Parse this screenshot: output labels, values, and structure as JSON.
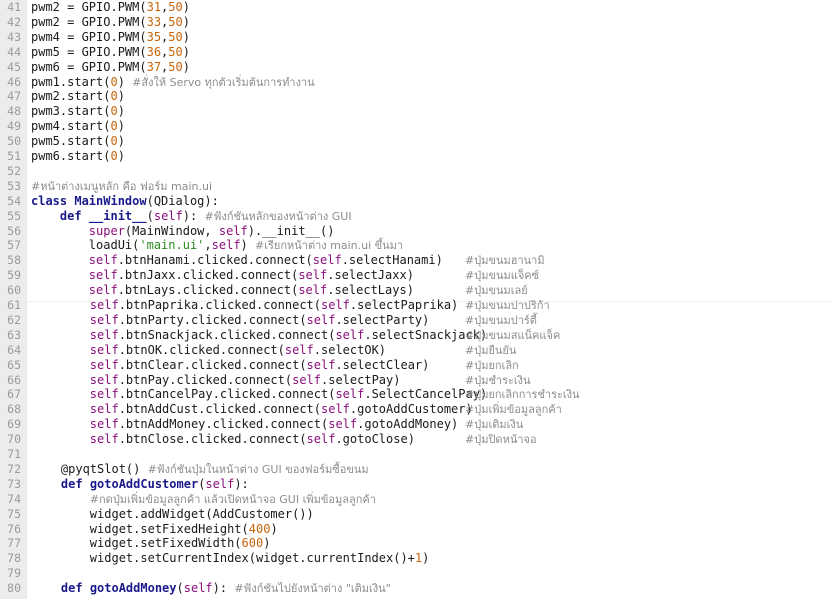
{
  "editor": {
    "lines": [
      {
        "num": "41",
        "tokens": [
          [
            "n",
            "pwm2 = GPIO.PWM("
          ],
          [
            "num",
            "31"
          ],
          [
            "n",
            ","
          ],
          [
            "num",
            "50"
          ],
          [
            "n",
            ")"
          ]
        ]
      },
      {
        "num": "42",
        "tokens": [
          [
            "n",
            "pwm2 = GPIO.PWM("
          ],
          [
            "num",
            "33"
          ],
          [
            "n",
            ","
          ],
          [
            "num",
            "50"
          ],
          [
            "n",
            ")"
          ]
        ]
      },
      {
        "num": "43",
        "tokens": [
          [
            "n",
            "pwm4 = GPIO.PWM("
          ],
          [
            "num",
            "35"
          ],
          [
            "n",
            ","
          ],
          [
            "num",
            "50"
          ],
          [
            "n",
            ")"
          ]
        ]
      },
      {
        "num": "44",
        "tokens": [
          [
            "n",
            "pwm5 = GPIO.PWM("
          ],
          [
            "num",
            "36"
          ],
          [
            "n",
            ","
          ],
          [
            "num",
            "50"
          ],
          [
            "n",
            ")"
          ]
        ]
      },
      {
        "num": "45",
        "tokens": [
          [
            "n",
            "pwm6 = GPIO.PWM("
          ],
          [
            "num",
            "37"
          ],
          [
            "n",
            ","
          ],
          [
            "num",
            "50"
          ],
          [
            "n",
            ")"
          ]
        ]
      },
      {
        "num": "46",
        "tokens": [
          [
            "n",
            "pwm1.start("
          ],
          [
            "num",
            "0"
          ],
          [
            "n",
            ") "
          ],
          [
            "cmt",
            "#สั่งให้ Servo ทุกตัวเริ่มต้นการทำงาน"
          ]
        ]
      },
      {
        "num": "47",
        "tokens": [
          [
            "n",
            "pwm2.start("
          ],
          [
            "num",
            "0"
          ],
          [
            "n",
            ")"
          ]
        ]
      },
      {
        "num": "48",
        "tokens": [
          [
            "n",
            "pwm3.start("
          ],
          [
            "num",
            "0"
          ],
          [
            "n",
            ")"
          ]
        ]
      },
      {
        "num": "49",
        "tokens": [
          [
            "n",
            "pwm4.start("
          ],
          [
            "num",
            "0"
          ],
          [
            "n",
            ")"
          ]
        ]
      },
      {
        "num": "50",
        "tokens": [
          [
            "n",
            "pwm5.start("
          ],
          [
            "num",
            "0"
          ],
          [
            "n",
            ")"
          ]
        ]
      },
      {
        "num": "51",
        "tokens": [
          [
            "n",
            "pwm6.start("
          ],
          [
            "num",
            "0"
          ],
          [
            "n",
            ")"
          ]
        ]
      },
      {
        "num": "52",
        "tokens": []
      },
      {
        "num": "53",
        "tokens": [
          [
            "cmt",
            "#หน้าต่างเมนูหลัก คือ ฟอร์ม main.ui"
          ]
        ]
      },
      {
        "num": "54",
        "tokens": [
          [
            "kw",
            "class "
          ],
          [
            "cls",
            "MainWindow"
          ],
          [
            "n",
            "(QDialog):"
          ]
        ]
      },
      {
        "num": "55",
        "tokens": [
          [
            "n",
            "    "
          ],
          [
            "kw",
            "def "
          ],
          [
            "fn",
            "__init__"
          ],
          [
            "n",
            "("
          ],
          [
            "self",
            "self"
          ],
          [
            "n",
            "): "
          ],
          [
            "cmt",
            "#ฟังก์ชันหลักของหน้าต่าง GUI"
          ]
        ]
      },
      {
        "num": "56",
        "tokens": [
          [
            "n",
            "        "
          ],
          [
            "self",
            "super"
          ],
          [
            "n",
            "(MainWindow, "
          ],
          [
            "self",
            "self"
          ],
          [
            "n",
            ").__init__()"
          ]
        ]
      },
      {
        "num": "57",
        "tokens": [
          [
            "n",
            "        loadUi("
          ],
          [
            "str",
            "'main.ui'"
          ],
          [
            "n",
            ","
          ],
          [
            "self",
            "self"
          ],
          [
            "n",
            ") "
          ],
          [
            "cmt",
            "#เรียกหน้าต่าง main.ui ขึ้นมา"
          ]
        ]
      },
      {
        "num": "58",
        "tokens": [
          [
            "n",
            "        "
          ],
          [
            "self",
            "self"
          ],
          [
            "n",
            ".btnHanami.clicked.connect("
          ],
          [
            "self",
            "self"
          ],
          [
            "n",
            ".selectHanami)"
          ]
        ],
        "comment": "#ปุ่มขนมฮานามิ"
      },
      {
        "num": "59",
        "tokens": [
          [
            "n",
            "        "
          ],
          [
            "self",
            "self"
          ],
          [
            "n",
            ".btnJaxx.clicked.connect("
          ],
          [
            "self",
            "self"
          ],
          [
            "n",
            ".selectJaxx)"
          ]
        ],
        "comment": "#ปุ่มขนมแจ็คซ์"
      },
      {
        "num": "60",
        "tokens": [
          [
            "n",
            "        "
          ],
          [
            "self",
            "self"
          ],
          [
            "n",
            ".btnLays.clicked.connect("
          ],
          [
            "self",
            "self"
          ],
          [
            "n",
            ".selectLays)"
          ]
        ],
        "comment": "#ปุ่มขนมเลย์"
      },
      {
        "num": "61",
        "shift": true,
        "tokens": [
          [
            "n",
            "        "
          ],
          [
            "self",
            "self"
          ],
          [
            "n",
            ".btnPaprika.clicked.connect("
          ],
          [
            "self",
            "self"
          ],
          [
            "n",
            ".selectPaprika)"
          ]
        ],
        "comment": "#ปุ่มขนมปาปริก้า"
      },
      {
        "num": "62",
        "shift": true,
        "tokens": [
          [
            "n",
            "        "
          ],
          [
            "self",
            "self"
          ],
          [
            "n",
            ".btnParty.clicked.connect("
          ],
          [
            "self",
            "self"
          ],
          [
            "n",
            ".selectParty)"
          ]
        ],
        "comment": "#ปุ่มขนมปาร์ตี้"
      },
      {
        "num": "63",
        "shift": true,
        "tokens": [
          [
            "n",
            "        "
          ],
          [
            "self",
            "self"
          ],
          [
            "n",
            ".btnSnackjack.clicked.connect("
          ],
          [
            "self",
            "self"
          ],
          [
            "n",
            ".selectSnackjack)"
          ]
        ],
        "comment": "#ปุ่มขนมสแน็คแจ็ค"
      },
      {
        "num": "64",
        "shift": true,
        "tokens": [
          [
            "n",
            "        "
          ],
          [
            "self",
            "self"
          ],
          [
            "n",
            ".btnOK.clicked.connect("
          ],
          [
            "self",
            "self"
          ],
          [
            "n",
            ".selectOK)"
          ]
        ],
        "comment": "#ปุ่มยืนยัน"
      },
      {
        "num": "65",
        "shift": true,
        "tokens": [
          [
            "n",
            "        "
          ],
          [
            "self",
            "self"
          ],
          [
            "n",
            ".btnClear.clicked.connect("
          ],
          [
            "self",
            "self"
          ],
          [
            "n",
            ".selectClear)"
          ]
        ],
        "comment": "#ปุ่มยกเลิก"
      },
      {
        "num": "66",
        "shift": true,
        "tokens": [
          [
            "n",
            "        "
          ],
          [
            "self",
            "self"
          ],
          [
            "n",
            ".btnPay.clicked.connect("
          ],
          [
            "self",
            "self"
          ],
          [
            "n",
            ".selectPay)"
          ]
        ],
        "comment": "#ปุ่มชำระเงิน"
      },
      {
        "num": "67",
        "shift": true,
        "tokens": [
          [
            "n",
            "        "
          ],
          [
            "self",
            "self"
          ],
          [
            "n",
            ".btnCancelPay.clicked.connect("
          ],
          [
            "self",
            "self"
          ],
          [
            "n",
            ".SelectCancelPay)"
          ]
        ],
        "comment": "#ปุ่มยกเลิกการชำระเงิน"
      },
      {
        "num": "68",
        "shift": true,
        "tokens": [
          [
            "n",
            "        "
          ],
          [
            "self",
            "self"
          ],
          [
            "n",
            ".btnAddCust.clicked.connect("
          ],
          [
            "self",
            "self"
          ],
          [
            "n",
            ".gotoAddCustomer)"
          ]
        ],
        "comment": "#ปุ่มเพิ่มข้อมูลลูกค้า"
      },
      {
        "num": "69",
        "shift": true,
        "tokens": [
          [
            "n",
            "        "
          ],
          [
            "self",
            "self"
          ],
          [
            "n",
            ".btnAddMoney.clicked.connect("
          ],
          [
            "self",
            "self"
          ],
          [
            "n",
            ".gotoAddMoney)"
          ]
        ],
        "comment": "#ปุ่มเติมเงิน"
      },
      {
        "num": "70",
        "shift": true,
        "tokens": [
          [
            "n",
            "        "
          ],
          [
            "self",
            "self"
          ],
          [
            "n",
            ".btnClose.clicked.connect("
          ],
          [
            "self",
            "self"
          ],
          [
            "n",
            ".gotoClose)"
          ]
        ],
        "comment": "#ปุ่มปิดหน้าจอ"
      },
      {
        "num": "71",
        "shift": true,
        "tokens": []
      },
      {
        "num": "72",
        "shift": true,
        "tokens": [
          [
            "n",
            "    @pyqtSlot() "
          ],
          [
            "cmt",
            "#ฟังก์ชันปุ่มในหน้าต่าง GUI ของฟอร์มซื้อขนม"
          ]
        ]
      },
      {
        "num": "73",
        "shift": true,
        "tokens": [
          [
            "n",
            "    "
          ],
          [
            "kw",
            "def "
          ],
          [
            "fn",
            "gotoAddCustomer"
          ],
          [
            "n",
            "("
          ],
          [
            "self",
            "self"
          ],
          [
            "n",
            "):"
          ]
        ]
      },
      {
        "num": "74",
        "shift": true,
        "tokens": [
          [
            "n",
            "        "
          ],
          [
            "cmt",
            "#กดปุ่มเพิ่มข้อมูลลูกค้า แล้วเปิดหน้าจอ GUI เพิ่มข้อมูลลูกค้า"
          ]
        ]
      },
      {
        "num": "75",
        "shift": true,
        "tokens": [
          [
            "n",
            "        widget.addWidget(AddCustomer())"
          ]
        ]
      },
      {
        "num": "76",
        "shift": true,
        "tokens": [
          [
            "n",
            "        widget.setFixedHeight("
          ],
          [
            "num",
            "400"
          ],
          [
            "n",
            ")"
          ]
        ]
      },
      {
        "num": "77",
        "shift": true,
        "tokens": [
          [
            "n",
            "        widget.setFixedWidth("
          ],
          [
            "num",
            "600"
          ],
          [
            "n",
            ")"
          ]
        ]
      },
      {
        "num": "78",
        "shift": true,
        "tokens": [
          [
            "n",
            "        widget.setCurrentIndex(widget.currentIndex()+"
          ],
          [
            "num",
            "1"
          ],
          [
            "n",
            ")"
          ]
        ]
      },
      {
        "num": "79",
        "shift": true,
        "tokens": []
      },
      {
        "num": "80",
        "shift": true,
        "tokens": [
          [
            "n",
            "    "
          ],
          [
            "kw",
            "def "
          ],
          [
            "fn",
            "gotoAddMoney"
          ],
          [
            "n",
            "("
          ],
          [
            "self",
            "self"
          ],
          [
            "n",
            "): "
          ],
          [
            "cmt",
            "#ฟังก์ชันไปยังหน้าต่าง \"เติมเงิน\""
          ]
        ]
      }
    ]
  }
}
